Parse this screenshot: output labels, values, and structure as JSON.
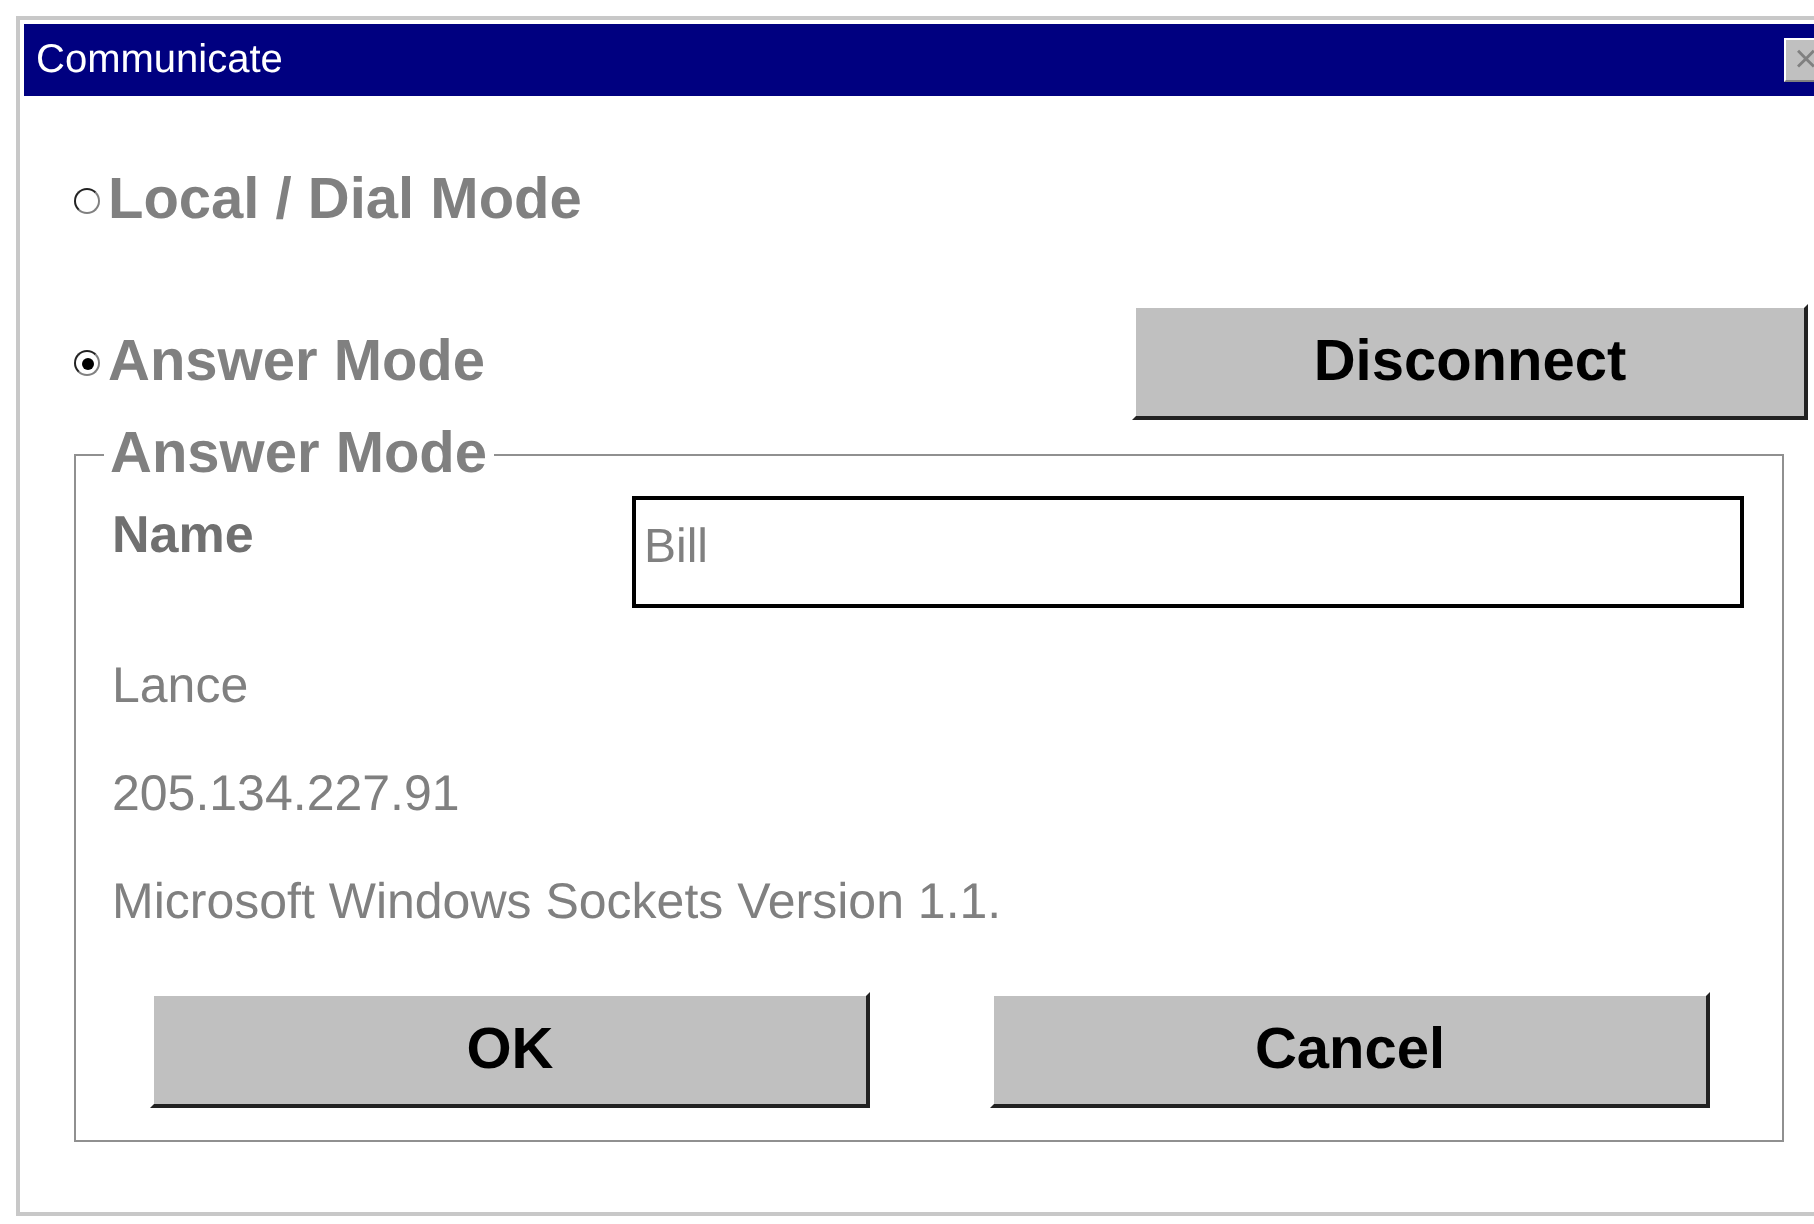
{
  "window": {
    "title": "Communicate",
    "close": "×"
  },
  "modes": [
    {
      "label": "Local / Dial Mode",
      "selected": false,
      "disabled": true
    },
    {
      "label": "Answer Mode",
      "selected": true,
      "disabled": true
    }
  ],
  "disconnect_button": "Disconnect",
  "group": {
    "title": "Answer Mode",
    "name_label": "Name",
    "name_value": "Bill",
    "info": [
      "Lance",
      "205.134.227.91",
      "Microsoft Windows Sockets Version 1.1."
    ]
  },
  "buttons": [
    "OK",
    "Cancel"
  ]
}
